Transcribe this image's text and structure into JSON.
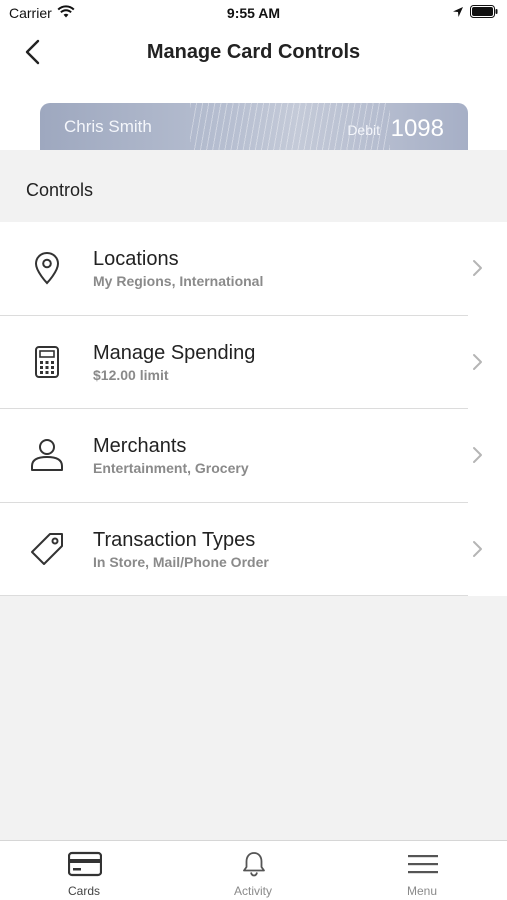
{
  "status_bar": {
    "carrier": "Carrier",
    "time": "9:55 AM"
  },
  "nav": {
    "title": "Manage Card Controls",
    "back_icon": "chevron-left-icon"
  },
  "card": {
    "holder_name": "Chris Smith",
    "type": "Debit",
    "last4": "1098"
  },
  "controls": {
    "section_label": "Controls",
    "items": [
      {
        "icon": "location-pin-icon",
        "title": "Locations",
        "subtitle": "My Regions, International"
      },
      {
        "icon": "calculator-icon",
        "title": "Manage Spending",
        "subtitle": "$12.00 limit"
      },
      {
        "icon": "person-icon",
        "title": "Merchants",
        "subtitle": "Entertainment, Grocery"
      },
      {
        "icon": "tag-icon",
        "title": "Transaction Types",
        "subtitle": "In Store, Mail/Phone Order"
      }
    ]
  },
  "tab_bar": {
    "tabs": [
      {
        "icon": "card-icon",
        "label": "Cards",
        "active": true
      },
      {
        "icon": "bell-icon",
        "label": "Activity",
        "active": false
      },
      {
        "icon": "menu-icon",
        "label": "Menu",
        "active": false
      }
    ]
  },
  "colors": {
    "card_gradient_start": "#9ea8bf",
    "card_gradient_end": "#a6afc6",
    "background": "#f2f2f2",
    "subtitle_gray": "#8a8a8a"
  }
}
